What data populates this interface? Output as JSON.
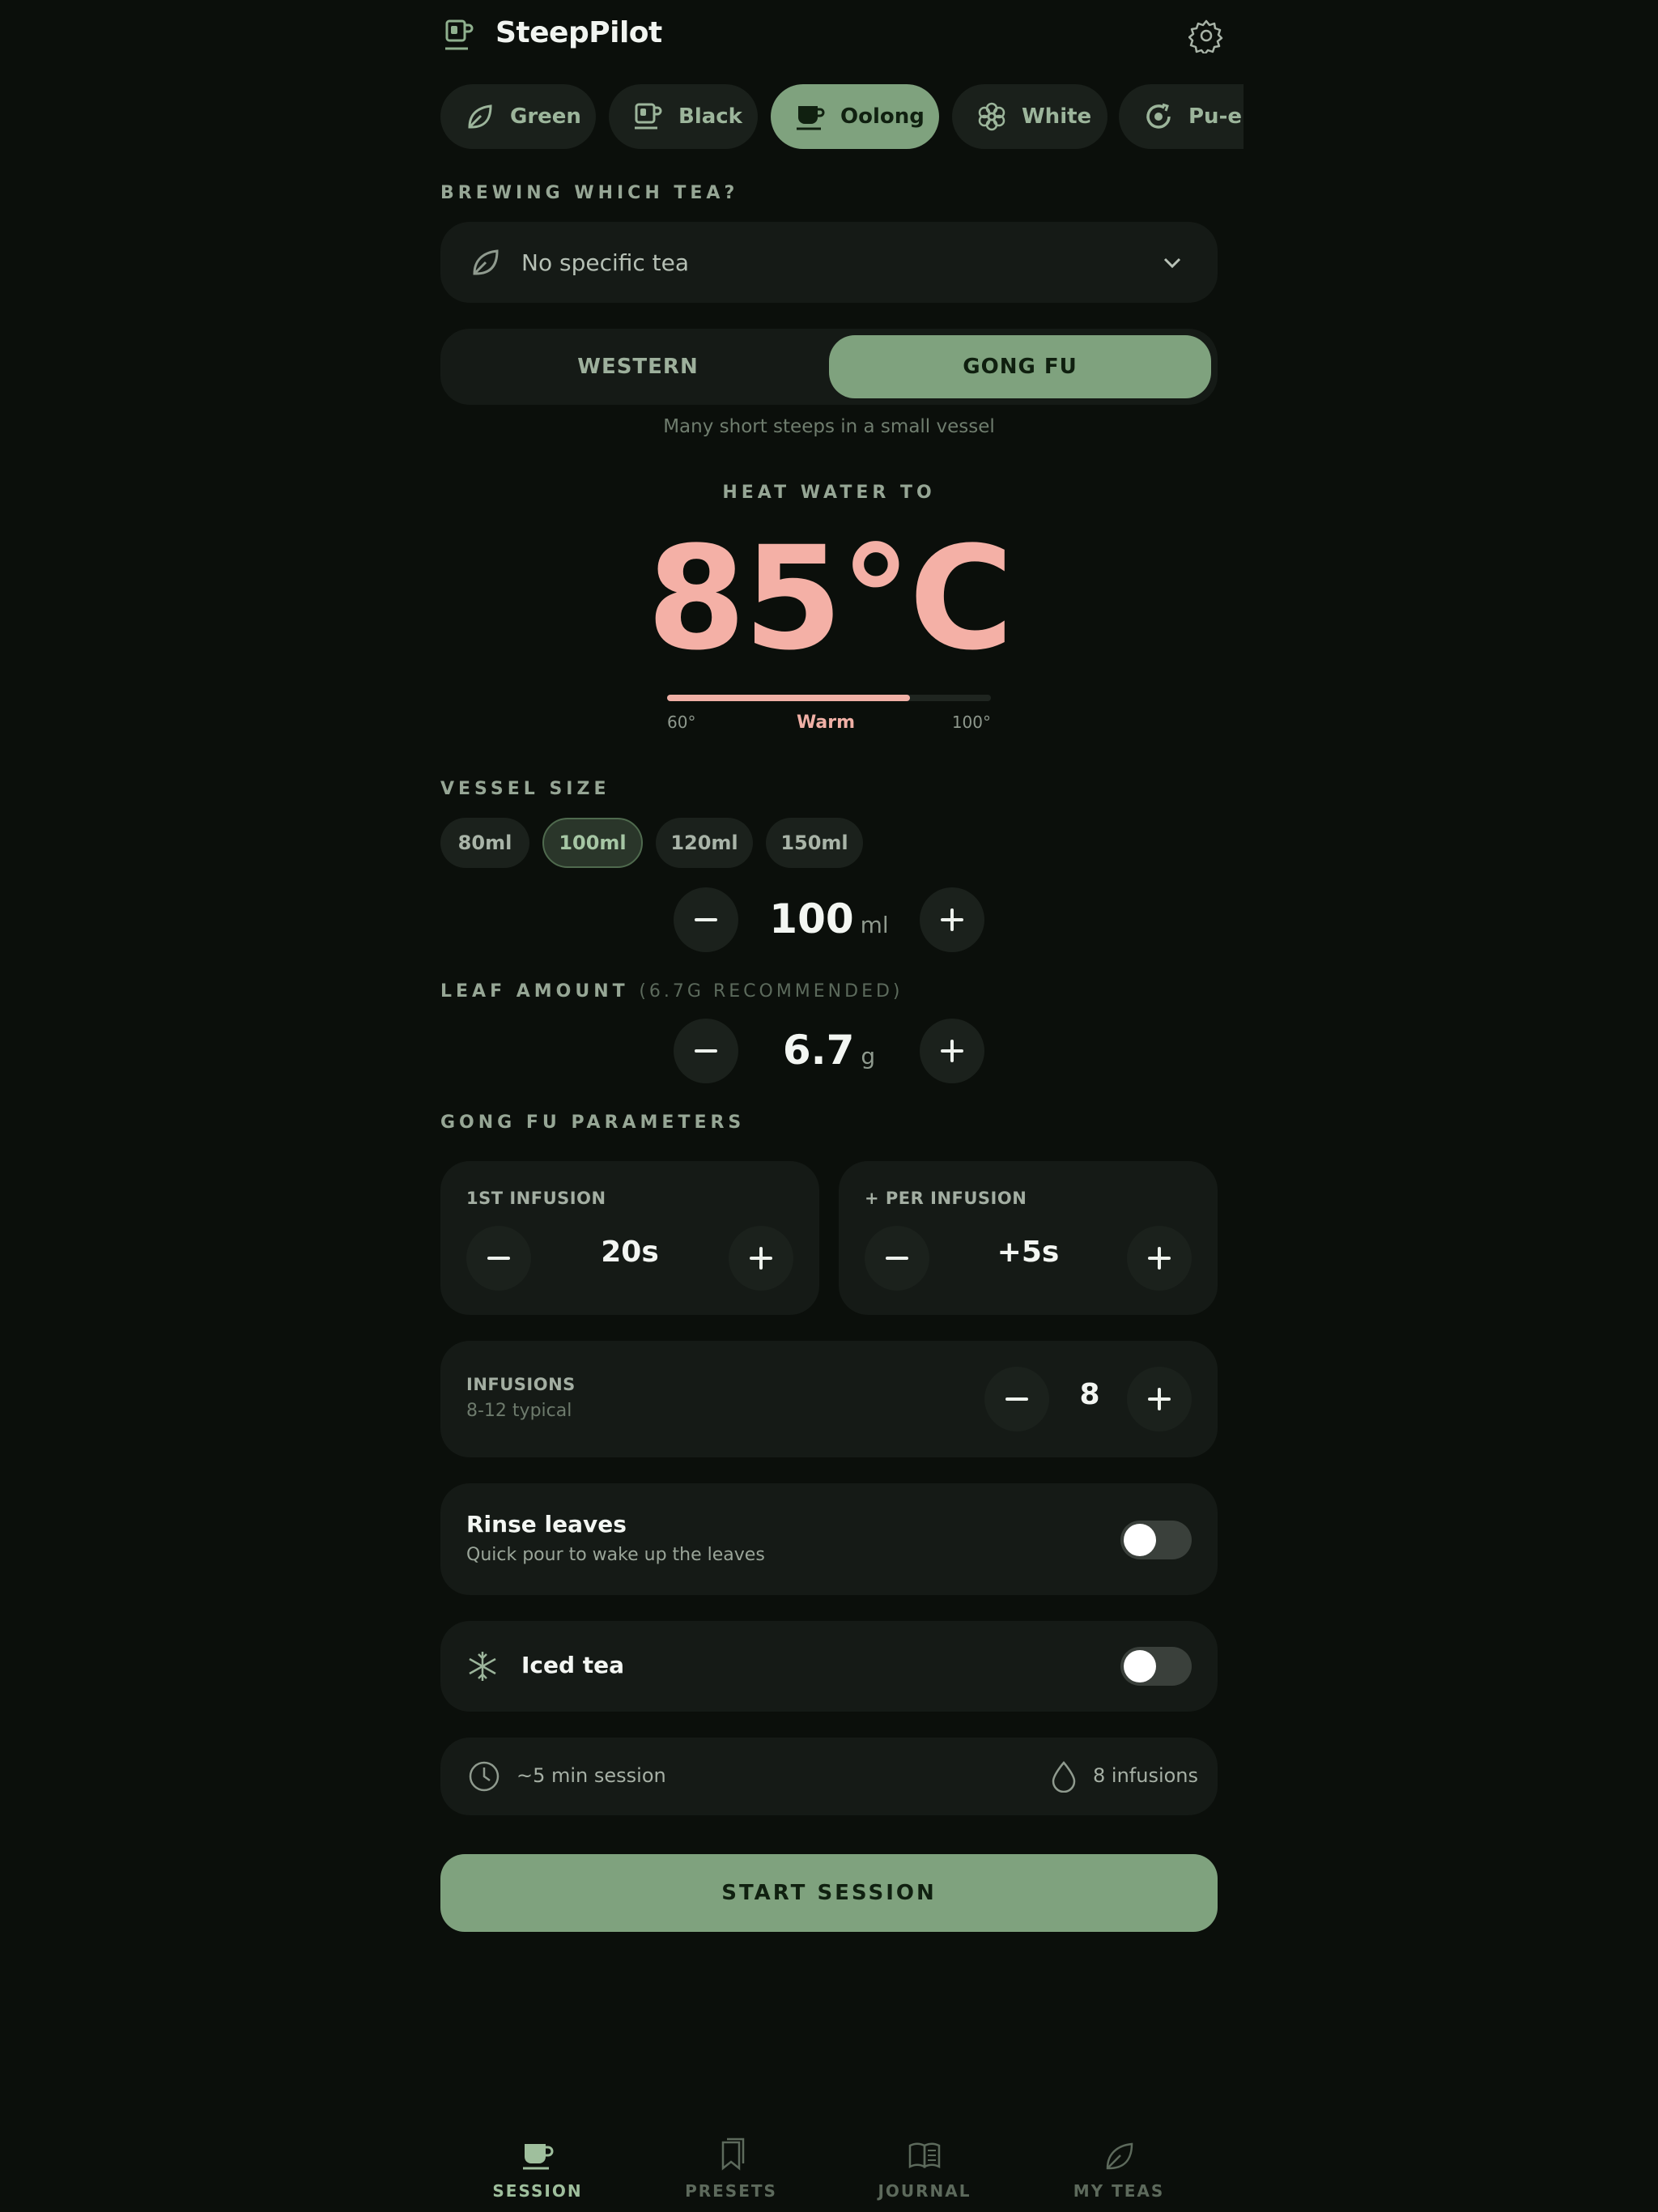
{
  "app": {
    "name": "SteepPilot"
  },
  "categories": [
    {
      "label": "Green",
      "icon": "leaf-icon"
    },
    {
      "label": "Black",
      "icon": "mug-icon"
    },
    {
      "label": "Oolong",
      "icon": "cup-icon",
      "active": true
    },
    {
      "label": "White",
      "icon": "flower-icon"
    },
    {
      "label": "Pu-erh",
      "icon": "cake-icon"
    }
  ],
  "tea_select": {
    "label": "BREWING WHICH TEA?",
    "value": "No specific tea"
  },
  "method": {
    "western": "WESTERN",
    "gongfu": "GONG FU",
    "selected": "GONG FU",
    "hint": "Many short steeps in a small vessel"
  },
  "temperature": {
    "label": "HEAT WATER TO",
    "display": "85°C",
    "min": "60°",
    "max": "100°",
    "descriptor": "Warm",
    "value": 85,
    "range": [
      60,
      100
    ]
  },
  "vessel": {
    "label": "VESSEL SIZE",
    "presets": [
      "80ml",
      "100ml",
      "120ml",
      "150ml"
    ],
    "selected": "100ml",
    "value": "100",
    "unit": "ml"
  },
  "leaf": {
    "label": "LEAF AMOUNT",
    "hint": "(6.7g recommended)",
    "value": "6.7",
    "unit": "g"
  },
  "gongfu": {
    "label": "GONG FU PARAMETERS",
    "first": {
      "label": "1ST INFUSION",
      "value": "20s"
    },
    "per": {
      "label": "+ PER INFUSION",
      "value": "+5s"
    },
    "infusions": {
      "label": "INFUSIONS",
      "sub": "8-12 typical",
      "value": "8"
    }
  },
  "rinse": {
    "title": "Rinse leaves",
    "sub": "Quick pour to wake up the leaves",
    "on": false
  },
  "iced": {
    "title": "Iced tea",
    "on": false
  },
  "summary": {
    "duration": "~5 min session",
    "infusions": "8 infusions"
  },
  "start_label": "START SESSION",
  "nav": [
    {
      "label": "SESSION",
      "icon": "cup-icon",
      "active": true
    },
    {
      "label": "PRESETS",
      "icon": "bookmark-icon"
    },
    {
      "label": "JOURNAL",
      "icon": "book-icon"
    },
    {
      "label": "MY TEAS",
      "icon": "leaf-icon"
    }
  ],
  "colors": {
    "accent": "#7fa27e",
    "temp": "#f4b0a6",
    "background": "#0b0f0b",
    "card": "#151a16"
  }
}
